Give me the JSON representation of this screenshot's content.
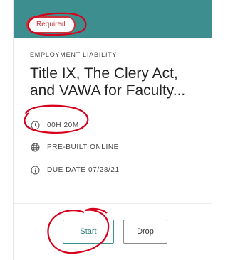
{
  "colors": {
    "header": "#3d8f8f",
    "required": "#c8343a",
    "start_border": "#3d8f8f",
    "annotation": "#d6001c"
  },
  "card": {
    "badge": "Required",
    "category": "EMPLOYMENT LIABILITY",
    "title_line1": "Title IX, The Clery Act,",
    "title_line2": "and VAWA for Faculty...",
    "meta": {
      "duration": {
        "icon": "clock-icon",
        "text": "00H 20M"
      },
      "format": {
        "icon": "globe-icon",
        "text": "PRE-BUILT ONLINE"
      },
      "due": {
        "icon": "info-icon",
        "text": "DUE DATE 07/28/21"
      }
    },
    "buttons": {
      "start": "Start",
      "drop": "Drop"
    }
  }
}
